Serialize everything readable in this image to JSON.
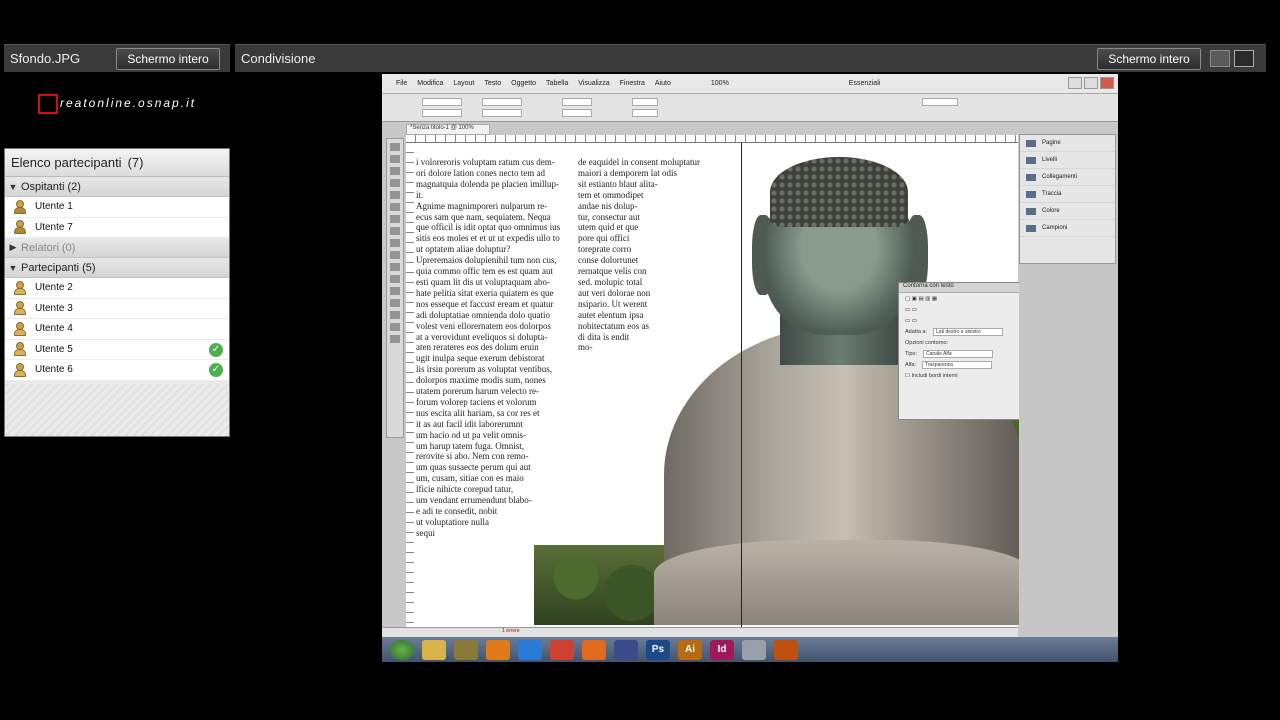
{
  "left_pod": {
    "title": "Sfondo.JPG",
    "fullscreen_label": "Schermo intero"
  },
  "share_pod": {
    "title": "Condivisione",
    "fullscreen_label": "Schermo intero"
  },
  "logo_text": "reatonline.osnap.it",
  "participants": {
    "header": "Elenco partecipanti",
    "count": "(7)",
    "groups": [
      {
        "label": "Ospitanti (2)",
        "users": [
          "Utente 1",
          "Utente 7"
        ]
      },
      {
        "label": "Relatori (0)",
        "users": []
      },
      {
        "label": "Partecipanti (5)",
        "users": [
          "Utente 2",
          "Utente 3",
          "Utente 4",
          "Utente 5",
          "Utente 6"
        ]
      }
    ],
    "checked_users": [
      "Utente 5",
      "Utente 6"
    ]
  },
  "indesign": {
    "menu": [
      "File",
      "Modifica",
      "Layout",
      "Testo",
      "Oggetto",
      "Tabella",
      "Visualizza",
      "Finestra",
      "Aiuto"
    ],
    "zoom": "100%",
    "workspace": "Essenziali",
    "doc_tab": "*Senza titolo-1 @ 100%",
    "panels": [
      "Pagine",
      "Livelli",
      "Collegamenti",
      "Traccia",
      "Colore",
      "Campioni"
    ],
    "wrap_dialog": {
      "title": "Contorna con testo",
      "apply_label": "Adatta a:",
      "apply_value": "Lati destro e sinistro",
      "contour_options": "Opzioni contorno:",
      "type_label": "Tipo:",
      "type_value": "Canale Alfa",
      "alpha_label": "Alfa:",
      "alpha_value": "Trasparenza",
      "include_label": "Includi bordi interni"
    },
    "text_col1": "i voloreroris voluptam ratum cus dem-\nori dolore lation cones necto tem ad\nmagnatquia dolenda pe placien imillup-\nit.\nAgnime magnimporeri nulparum re-\necus sam que nam, sequiatem. Nequa\nque officil is idit optat quo omnimus ius\nsitis eos moles et et ut ut expedis ullo to\nut optatem aliae doluptur?\nUpreremaios dolupienihil tum non cus,\nquia commo offic tem es est quam aut\nesti quam lit dis ut voluptaquam abo-\nhate pelitia sitat exeria quiatem es que\nnos esseque et faccust eream et quatur\nadi doluptatiae omnienda dolo quatio\nvolest veni ellorernatem eos dolorpos\nat a verovidunt eveliquos si dolupta-\naten rerateres eos des dolum eruin\nugit inulpa seque exerum debistorat\nlis irsin porerum as voluptat ventibus,\ndolorpos maxime modis sum, nones\nutatem porerum harum velecto re-\nforum volorep taciens et volorum\nnus escita alit hariam, sa cor res et\nit as aut facil idit laborerumnt\num hacio od ut pa velit omnis-\num harup tatem fuga. Omnist,\nrerovite si abo. Nem con remo-\num quas susaecte perum qui aut\num, cusam, sitiae con es maio\nlficie nihicte corepud tatur,\num vendant errumendunt blabo-\ne adi te consedit, nobit\nut voluptatiore nulla\nsequi",
    "text_col2": "de eaquidel in consent moluptatur\nmaiori a demporem lat odis\nsit estianto blaut alita-\ntem et ommodipet\nandae nis dolup-\ntur, consectur aut\nutem quid et que\npore qui offici\ntoreprate corro\nconse dolorrunet\nrernatque velis con\nsed. molupic total\naut veri dolorae non\nnsipario. Ut werent\nautet elentum ipsa\nnobitectatum eos as\ndi dita is endit\nmo-",
    "status": "1 errore"
  }
}
